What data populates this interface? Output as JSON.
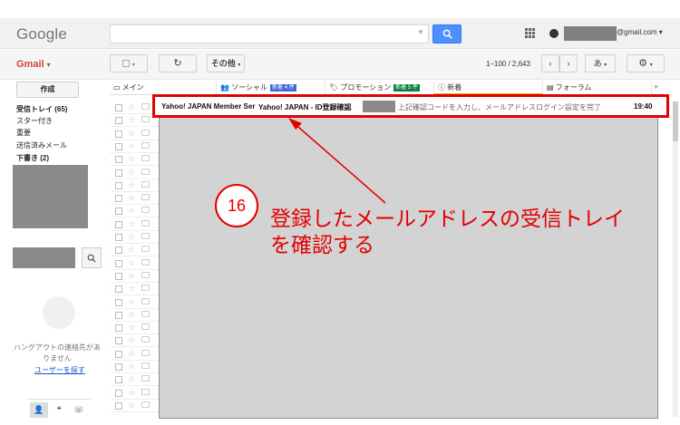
{
  "header": {
    "logo": "Google",
    "account": "@gmail.com ▾"
  },
  "toolbar": {
    "app_label": "Gmail",
    "more_label": "その他",
    "paging": "1–100 / 2,643",
    "input_tool": "あ"
  },
  "sidebar": {
    "compose": "作成",
    "items": [
      {
        "label": "受信トレイ (65)",
        "bold": true
      },
      {
        "label": "スター付き",
        "bold": false
      },
      {
        "label": "重要",
        "bold": false
      },
      {
        "label": "送信済みメール",
        "bold": false
      },
      {
        "label": "下書き (2)",
        "bold": true
      }
    ],
    "hangouts_text": "ハングアウトの連絡先がありません",
    "find_users": "ユーザーを探す"
  },
  "tabs": [
    {
      "label": "メイン",
      "icon": "inbox-icon",
      "badge": ""
    },
    {
      "label": "ソーシャル",
      "icon": "people-icon",
      "badge": "新着 4 件",
      "badge_color": "#3f6ad8"
    },
    {
      "label": "プロモーション",
      "icon": "tag-icon",
      "badge": "新着 5 件",
      "badge_color": "#0b8043"
    },
    {
      "label": "新着",
      "icon": "info-icon",
      "badge": ""
    },
    {
      "label": "フォーラム",
      "icon": "forum-icon",
      "badge": ""
    }
  ],
  "highlighted_email": {
    "sender": "Yahoo! JAPAN Member Ser",
    "subject": "Yahoo! JAPAN - ID登録確認",
    "snippet": "上記確認コードを入力し、メールアドレスログイン設定を完了",
    "time": "19:40"
  },
  "annotation": {
    "step": "16",
    "line1": "登録したメールアドレスの受信トレイ",
    "line2": "を確認する",
    "color": "#e30000"
  }
}
